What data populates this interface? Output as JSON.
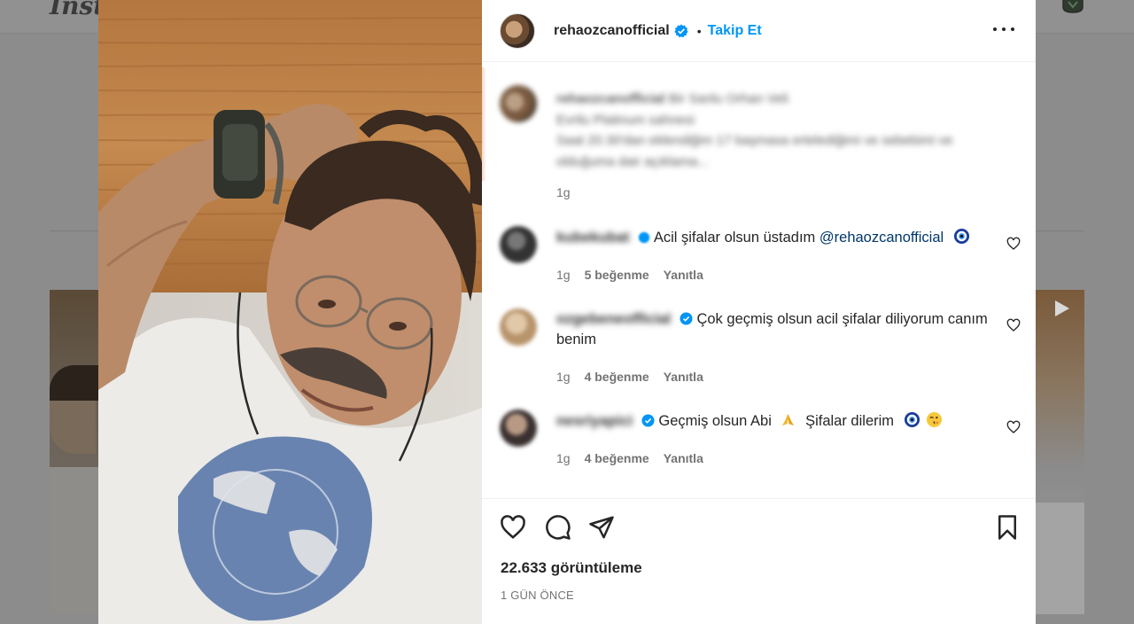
{
  "background": {
    "logo_text": "Insta"
  },
  "post": {
    "username": "rehaozcanofficial",
    "separator": "•",
    "follow_label": "Takip Et",
    "caption": {
      "username": "rehaozcanofficial",
      "lines": [
        "Bir Sanlu Orhan Veli",
        "Evrilu Platinum sahnesi",
        "Saat 20.30'dan eklendiğim 17 başmasa ertelediğimi ve sebebimi ve",
        "olduğuma dair açıklama..."
      ],
      "time": "1g"
    },
    "comments": [
      {
        "username": "kubekubat",
        "text": "Acil şifalar olsun üstadım",
        "mention": "@rehaozcanofficial",
        "emoji": [
          "nazar"
        ],
        "time": "1g",
        "likes": "5 beğenme",
        "reply": "Yanıtla"
      },
      {
        "username": "ozgebeneofficial",
        "text": "Çok geçmiş olsun acil şifalar diliyorum canım benim",
        "emoji": [],
        "time": "1g",
        "likes": "4 beğenme",
        "reply": "Yanıtla"
      },
      {
        "username": "nesriyapici",
        "text": "Geçmiş olsun Abi",
        "text2": "Şifalar dilerim",
        "emoji": [
          "pray",
          "nazar",
          "wink-kiss"
        ],
        "time": "1g",
        "likes": "4 beğenme",
        "reply": "Yanıtla"
      }
    ],
    "views": "22.633 görüntüleme",
    "date": "1 GÜN ÖNCE",
    "icons": [
      "more-icon",
      "heart-icon",
      "comment-icon",
      "share-icon",
      "save-icon",
      "verified-icon"
    ],
    "accent_color": "#0095f6"
  }
}
